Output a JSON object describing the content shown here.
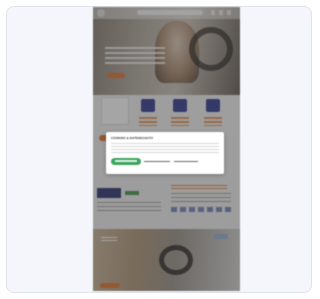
{
  "dialog": {
    "title": "COOKIES & DATENSCHUTZ"
  }
}
